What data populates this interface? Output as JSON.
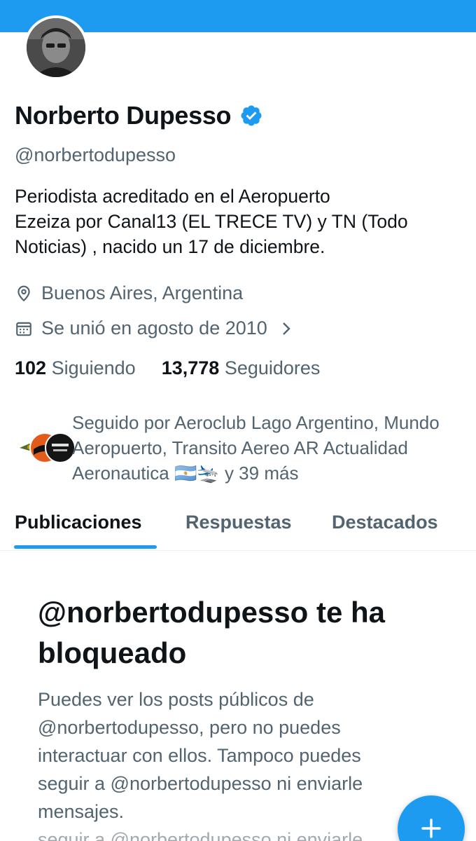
{
  "colors": {
    "accent": "#1d9bf0",
    "text": "#0f1419",
    "muted": "#536471"
  },
  "profile": {
    "name": "Norberto Dupesso",
    "handle": "@norbertodupesso",
    "bio_lines": [
      "Periodista acreditado en el Aeropuerto",
      "Ezeiza por Canal13 (EL TRECE TV) y TN (Todo",
      "Noticias)  , nacido un 17 de diciembre."
    ],
    "location": "Buenos Aires, Argentina",
    "joined": "Se unió en agosto de 2010",
    "following_count": "102",
    "following_label": "Siguiendo",
    "followers_count": "13,778",
    "followers_label": "Seguidores",
    "followed_by_lines": [
      "Seguido por Aeroclub Lago Argentino, Mundo",
      "Aeropuerto, Transito Aereo AR Actualidad",
      "Aeronautica 🇦🇷🛬 y 39 más"
    ]
  },
  "tabs": [
    {
      "label": "Publicaciones",
      "active": true
    },
    {
      "label": "Respuestas",
      "active": false
    },
    {
      "label": "Destacados",
      "active": false
    }
  ],
  "blocked": {
    "title_lines": [
      "@norbertodupesso te ha",
      "bloqueado"
    ],
    "body_lines": [
      "Puedes ver los posts públicos de",
      "@norbertodupesso, pero no puedes",
      "interactuar con ellos. Tampoco puedes",
      "seguir a @norbertodupesso ni enviarle",
      "mensajes.",
      "seguir a @norbertodupesso ni enviarle"
    ]
  },
  "icons": {
    "verified": "verified-badge-icon",
    "location": "location-pin-icon",
    "calendar": "calendar-icon",
    "chevron": "chevron-right-icon",
    "fab": "plus-icon"
  }
}
